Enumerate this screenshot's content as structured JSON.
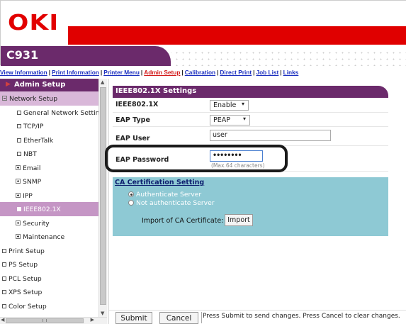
{
  "header": {
    "logo": "OKI",
    "model": "C931"
  },
  "nav": {
    "links": [
      "View Information",
      "Print Information",
      "Printer Menu",
      "Admin Setup",
      "Calibration",
      "Direct Print",
      "Job List",
      "Links"
    ],
    "active": "Admin Setup"
  },
  "sidebar": {
    "title": "Admin Setup",
    "items": [
      {
        "label": "Network Setup"
      },
      {
        "label": "General Network Setting"
      },
      {
        "label": "TCP/IP"
      },
      {
        "label": "EtherTalk"
      },
      {
        "label": "NBT"
      },
      {
        "label": "Email"
      },
      {
        "label": "SNMP"
      },
      {
        "label": "IPP"
      },
      {
        "label": "IEEE802.1X"
      },
      {
        "label": "Security"
      },
      {
        "label": "Maintenance"
      },
      {
        "label": "Print Setup"
      },
      {
        "label": "PS Setup"
      },
      {
        "label": "PCL Setup"
      },
      {
        "label": "XPS Setup"
      },
      {
        "label": "Color Setup"
      }
    ]
  },
  "settings": {
    "title": "IEEE802.1X Settings",
    "ieee_label": "IEEE802.1X",
    "ieee_value": "Enable",
    "eap_type_label": "EAP Type",
    "eap_type_value": "PEAP",
    "eap_user_label": "EAP User",
    "eap_user_value": "user",
    "eap_password_label": "EAP Password",
    "eap_password_value": "••••••••",
    "eap_password_hint": "(Max.64 characters)"
  },
  "ca": {
    "title": "CA Certification Setting",
    "option_authenticate": "Authenticate Server",
    "option_not_authenticate": "Not authenticate Server",
    "import_label": "Import of CA Certificate:",
    "import_button": "Import"
  },
  "footer": {
    "submit": "Submit",
    "cancel": "Cancel",
    "message": "Press Submit to send changes. Press Cancel to clear changes."
  },
  "colors": {
    "brand_red": "#e00000",
    "brand_purple": "#6b2a6b",
    "ca_panel": "#8ec9d4",
    "active_link": "#d21a1a"
  }
}
